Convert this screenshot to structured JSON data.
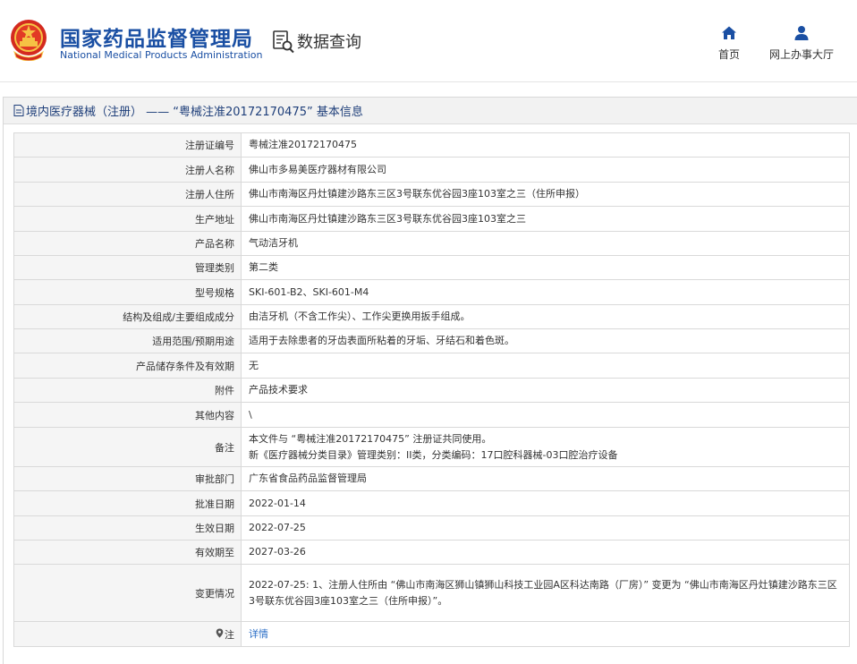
{
  "header": {
    "title_cn": "国家药品监督管理局",
    "title_en": "National Medical Products Administration",
    "query_label": "数据查询",
    "query_icon": "search-doc-icon",
    "nav": [
      {
        "label": "首页",
        "icon": "home-icon"
      },
      {
        "label": "网上办事大厅",
        "icon": "user-icon"
      }
    ],
    "brand_color": "#1a4fa3"
  },
  "panel": {
    "heading": "境内医疗器械（注册） —— “粤械注准20172170475” 基本信息"
  },
  "rows": [
    {
      "key": "注册证编号",
      "value": "粤械注准20172170475"
    },
    {
      "key": "注册人名称",
      "value": "佛山市多易美医疗器材有限公司"
    },
    {
      "key": "注册人住所",
      "value": "佛山市南海区丹灶镇建沙路东三区3号联东优谷园3座103室之三（住所申报）"
    },
    {
      "key": "生产地址",
      "value": "佛山市南海区丹灶镇建沙路东三区3号联东优谷园3座103室之三"
    },
    {
      "key": "产品名称",
      "value": "气动洁牙机"
    },
    {
      "key": "管理类别",
      "value": "第二类"
    },
    {
      "key": "型号规格",
      "value": "SKI-601-B2、SKI-601-M4"
    },
    {
      "key": "结构及组成/主要组成成分",
      "value": "由洁牙机（不含工作尖）、工作尖更换用扳手组成。"
    },
    {
      "key": "适用范围/预期用途",
      "value": "适用于去除患者的牙齿表面所粘着的牙垢、牙结石和着色斑。"
    },
    {
      "key": "产品储存条件及有效期",
      "value": "无"
    },
    {
      "key": "附件",
      "value": "产品技术要求"
    },
    {
      "key": "其他内容",
      "value": "\\"
    },
    {
      "key": "备注",
      "value": "本文件与 “粤械注准20172170475” 注册证共同使用。",
      "value2": "新《医疗器械分类目录》管理类别：II类，分类编码：17口腔科器械-03口腔治疗设备"
    },
    {
      "key": "审批部门",
      "value": "广东省食品药品监督管理局"
    },
    {
      "key": "批准日期",
      "value": "2022-01-14"
    },
    {
      "key": "生效日期",
      "value": "2022-07-25"
    },
    {
      "key": "有效期至",
      "value": "2027-03-26"
    },
    {
      "key": "变更情况",
      "value": "2022-07-25: 1、注册人住所由 “佛山市南海区狮山镇狮山科技工业园A区科达南路（厂房）” 变更为 “佛山市南海区丹灶镇建沙路东三区3号联东优谷园3座103室之三（住所申报）”。"
    },
    {
      "key": "注",
      "value": "详情",
      "key_icon": "location-pin-icon"
    }
  ]
}
